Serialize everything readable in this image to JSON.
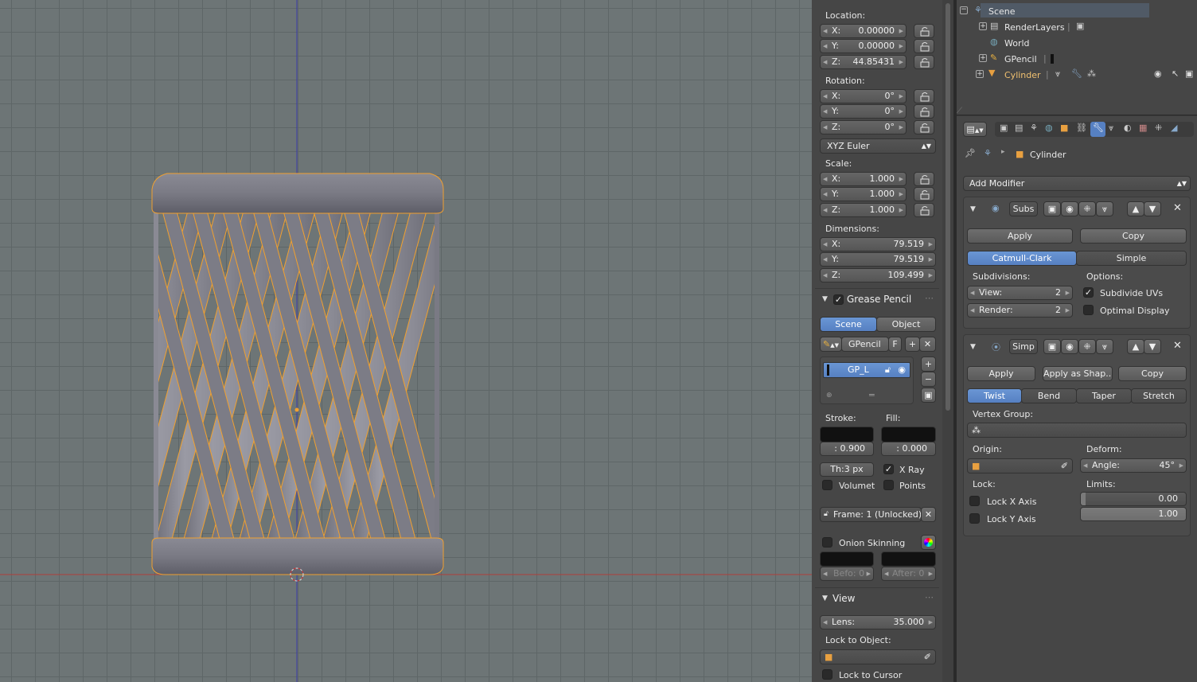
{
  "transform": {
    "location_label": "Location:",
    "location": {
      "x": "0.00000",
      "y": "0.00000",
      "z": "44.85431"
    },
    "rotation_label": "Rotation:",
    "rotation": {
      "x": "0°",
      "y": "0°",
      "z": "0°"
    },
    "rotation_mode": "XYZ Euler",
    "scale_label": "Scale:",
    "scale": {
      "x": "1.000",
      "y": "1.000",
      "z": "1.000"
    },
    "dimensions_label": "Dimensions:",
    "dimensions": {
      "x": "79.519",
      "y": "79.519",
      "z": "109.499"
    },
    "axis_x": "X:",
    "axis_y": "Y:",
    "axis_z": "Z:"
  },
  "grease_pencil": {
    "title": "Grease Pencil",
    "scene_tab": "Scene",
    "object_tab": "Object",
    "datablock": "GPencil",
    "fake_user": "F",
    "layer": "GP_L",
    "stroke_label": "Stroke:",
    "fill_label": "Fill:",
    "stroke_alpha": ": 0.900",
    "fill_alpha": ": 0.000",
    "thickness": "Th:3 px",
    "xray": "X Ray",
    "volumetric": "Volumet",
    "points": "Points",
    "frame": "Frame: 1 (Unlocked)",
    "onion": "Onion Skinning",
    "before": "Befo: 0",
    "after": "After: 0"
  },
  "view": {
    "title": "View",
    "lens_label": "Lens:",
    "lens": "35.000",
    "lock_object_label": "Lock to Object:",
    "lock_cursor": "Lock to Cursor"
  },
  "outliner": {
    "items": [
      {
        "label": "Scene"
      },
      {
        "label": "RenderLayers"
      },
      {
        "label": "World"
      },
      {
        "label": "GPencil"
      },
      {
        "label": "Cylinder"
      }
    ]
  },
  "properties": {
    "breadcrumb_object": "Cylinder",
    "add_modifier": "Add Modifier",
    "mod1": {
      "name": "Subs",
      "apply": "Apply",
      "copy": "Copy",
      "type_a": "Catmull-Clark",
      "type_b": "Simple",
      "subdivisions_label": "Subdivisions:",
      "options_label": "Options:",
      "view": "View:",
      "view_val": "2",
      "render": "Render:",
      "render_val": "2",
      "subdivide_uvs": "Subdivide UVs",
      "optimal_display": "Optimal Display"
    },
    "mod2": {
      "name": "Simp",
      "apply": "Apply",
      "apply_shape": "Apply as Shap...",
      "copy": "Copy",
      "modes": [
        "Twist",
        "Bend",
        "Taper",
        "Stretch"
      ],
      "vertex_group_label": "Vertex Group:",
      "origin_label": "Origin:",
      "deform_label": "Deform:",
      "angle_label": "Angle:",
      "angle": "45°",
      "lock_label": "Lock:",
      "limits_label": "Limits:",
      "lock_x": "Lock X Axis",
      "lock_y": "Lock Y Axis",
      "limit_min": "0.00",
      "limit_max": "1.00"
    }
  },
  "colors": {
    "accent": "#5680c2",
    "selection_outline": "#f0a030",
    "viewport_bg": "#6d7576"
  }
}
